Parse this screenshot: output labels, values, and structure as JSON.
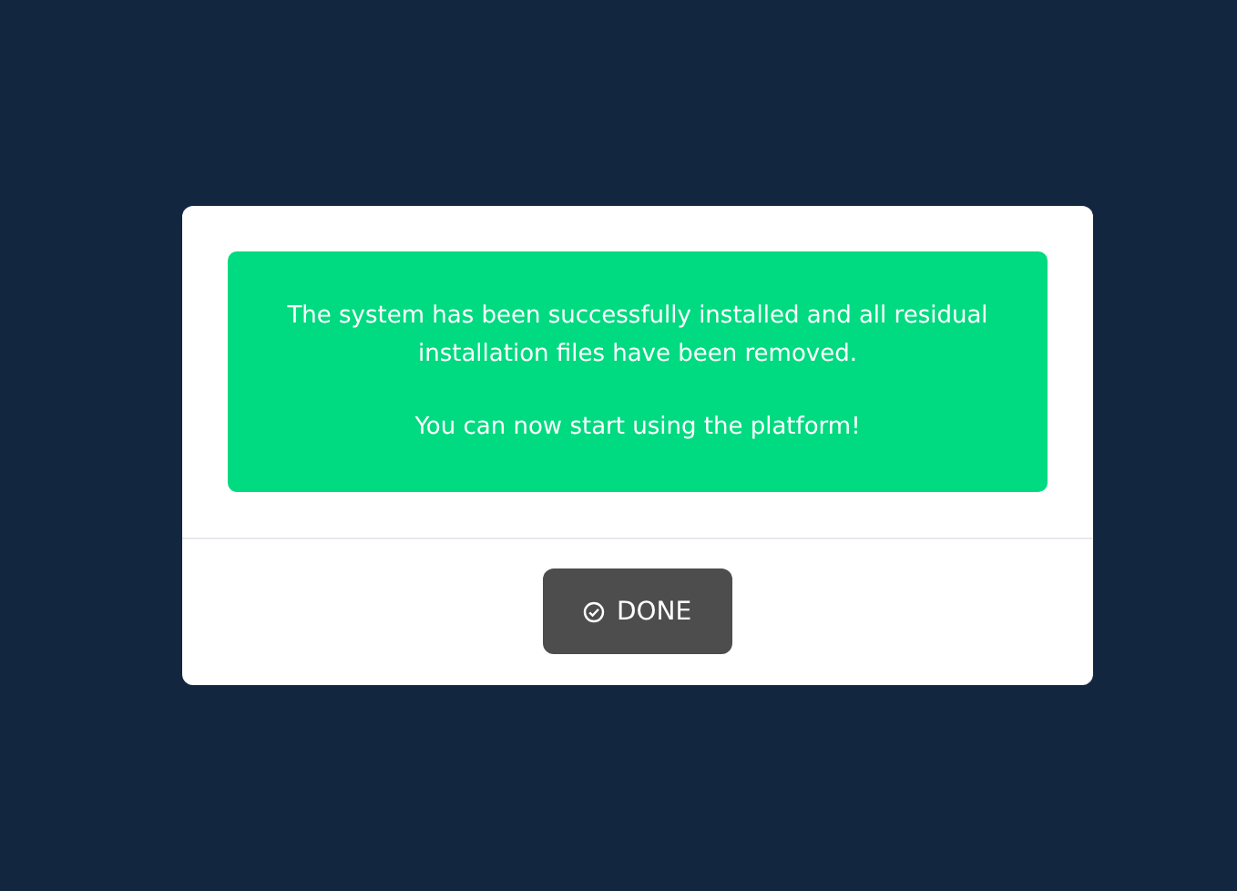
{
  "message": {
    "paragraphs": [
      "The system has been successfully installed and all residual installation files have been removed.",
      "You can now start using the platform!"
    ]
  },
  "done_button": {
    "label": "DONE"
  }
}
